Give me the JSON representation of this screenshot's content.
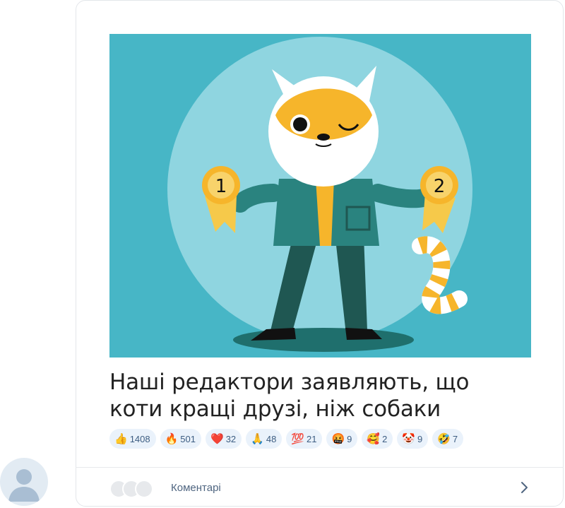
{
  "post": {
    "caption_line1": "Наші редактори заявляють, що",
    "caption_line2": "коти кращі друзі, ніж собаки",
    "image_alt": "Ілюстрація: кіт з медалями 1 і 2",
    "medal_1": "1",
    "medal_2": "2"
  },
  "reactions": [
    {
      "emoji": "👍",
      "count": "1408"
    },
    {
      "emoji": "🔥",
      "count": "501"
    },
    {
      "emoji": "❤️",
      "count": "32"
    },
    {
      "emoji": "🙏",
      "count": "48"
    },
    {
      "emoji": "💯",
      "count": "21"
    },
    {
      "emoji": "🤬",
      "count": "9"
    },
    {
      "emoji": "🥰",
      "count": "2"
    },
    {
      "emoji": "🤡",
      "count": "9"
    },
    {
      "emoji": "🤣",
      "count": "7"
    }
  ],
  "comments": {
    "label": "Коментарі"
  },
  "colors": {
    "accent": "#3d5d82",
    "hero_background": "#47b6c6",
    "reaction_background": "#eaf2fb"
  }
}
